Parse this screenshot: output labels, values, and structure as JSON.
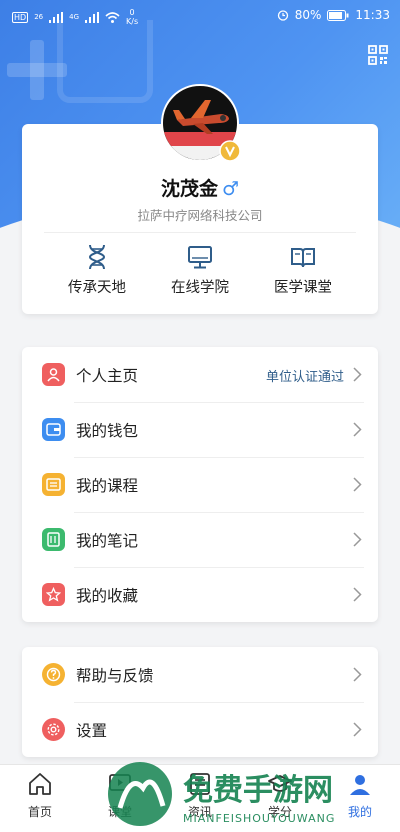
{
  "status_bar": {
    "left_labels": [
      "HD",
      "26",
      "4G"
    ],
    "net_speed": "0",
    "net_unit": "K/s",
    "battery": "80%",
    "time": "11:33"
  },
  "profile": {
    "name": "沈茂金",
    "gender_symbol": "♂",
    "company": "拉萨中疗网络科技公司"
  },
  "quick_links": [
    {
      "label": "传承天地",
      "icon": "dna-icon"
    },
    {
      "label": "在线学院",
      "icon": "monitor-icon"
    },
    {
      "label": "医学课堂",
      "icon": "book-icon"
    }
  ],
  "menu_group1": [
    {
      "label": "个人主页",
      "right_text": "单位认证通过",
      "icon": "person-icon",
      "color": "#ef5f5f"
    },
    {
      "label": "我的钱包",
      "right_text": "",
      "icon": "wallet-icon",
      "color": "#3d8df0"
    },
    {
      "label": "我的课程",
      "right_text": "",
      "icon": "course-icon",
      "color": "#f5b232"
    },
    {
      "label": "我的笔记",
      "right_text": "",
      "icon": "notes-icon",
      "color": "#3cba6e"
    },
    {
      "label": "我的收藏",
      "right_text": "",
      "icon": "star-icon",
      "color": "#ef5f5f"
    }
  ],
  "menu_group2": [
    {
      "label": "帮助与反馈",
      "icon": "help-icon",
      "color": "#f5b232"
    },
    {
      "label": "设置",
      "icon": "gear-icon",
      "color": "#ef5f5f"
    }
  ],
  "tabs": [
    {
      "label": "首页",
      "icon": "home-icon"
    },
    {
      "label": "课堂",
      "icon": "classroom-icon"
    },
    {
      "label": "资讯",
      "icon": "news-icon"
    },
    {
      "label": "学分",
      "icon": "graduation-cap-icon"
    },
    {
      "label": "我的",
      "icon": "user-icon",
      "active": true
    }
  ],
  "watermark": {
    "title": "免费手游网",
    "url": "MIANFEISHOUYOUWANG"
  }
}
